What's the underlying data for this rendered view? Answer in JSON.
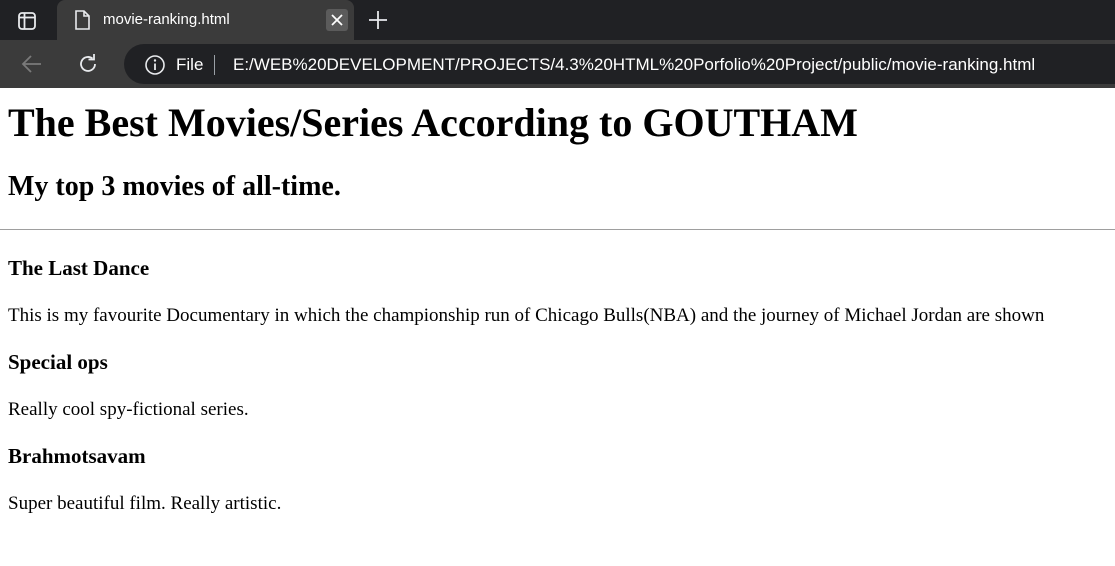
{
  "browser": {
    "tab_title": "movie-ranking.html",
    "address_scheme": "File",
    "address_url": "E:/WEB%20DEVELOPMENT/PROJECTS/4.3%20HTML%20Porfolio%20Project/public/movie-ranking.html",
    "icons": {
      "tab_actions": "tab-actions-icon",
      "tab_file": "file-icon",
      "tab_close": "close-icon",
      "new_tab": "plus-icon",
      "back": "back-arrow-icon",
      "reload": "reload-icon",
      "site_info": "info-icon"
    }
  },
  "page": {
    "title": "The Best Movies/Series According to GOUTHAM",
    "subtitle": "My top 3 movies of all-time.",
    "movies": [
      {
        "name": "The Last Dance",
        "description": "This is my favourite Documentary in which the championship run of Chicago Bulls(NBA) and the journey of Michael Jordan are shown"
      },
      {
        "name": "Special ops",
        "description": "Really cool spy-fictional series."
      },
      {
        "name": "Brahmotsavam",
        "description": "Super beautiful film. Really artistic."
      }
    ]
  }
}
